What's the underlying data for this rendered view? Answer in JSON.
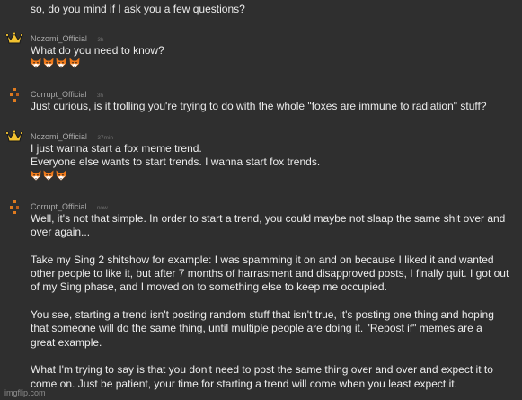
{
  "intro_text": "so, do you mind if I ask you a few questions?",
  "messages": [
    {
      "username": "Nozomi_Official",
      "time": "3h",
      "lines": [
        "What do you need to know?"
      ],
      "fox_count": 4
    },
    {
      "username": "Corrupt_Official",
      "time": "3h",
      "lines": [
        "Just curious, is it trolling you're trying to do with the whole \"foxes are immune to radiation\" stuff?"
      ]
    },
    {
      "username": "Nozomi_Official",
      "time": "37min",
      "lines": [
        "I just wanna start a fox meme trend.",
        "Everyone else wants to start trends. I wanna start fox trends."
      ],
      "fox_count": 3
    },
    {
      "username": "Corrupt_Official",
      "time": "now",
      "lines": [
        "Well, it's not that simple. In order to start a trend, you could maybe not slaap the same shit over and",
        "over again...",
        "",
        "Take my Sing 2 shitshow for example: I was spamming it on and on because I liked it and wanted",
        "other people to like it, but after 7 months of harrasment and disapproved posts, I finally quit. I got out",
        "of my Sing phase, and I moved on to something else to keep me occupied.",
        "",
        "You see, starting a trend isn't posting random stuff that isn't true, it's posting one thing and hoping",
        "that someone will do the same thing, until multiple people are doing it. \"Repost if\" memes are a",
        "great example.",
        "",
        "What I'm trying to say is that you don't need to post the same thing over and over and expect it to",
        "come on. Just be patient, your time for starting a trend will come when you least expect it."
      ]
    }
  ],
  "watermark": "imgflip.com",
  "colors": {
    "background": "#2f2f2f",
    "text": "#ececec",
    "username": "#a9a9a9",
    "timestamp": "#707070",
    "crown": "#f2c230",
    "corrupt_avatar": "#e07b1f",
    "fox": "#f07a1a"
  },
  "icons": {
    "nozomi_avatar": "crown-icon",
    "corrupt_avatar": "pixel-cross-icon",
    "fox": "fox-face-emoji"
  }
}
